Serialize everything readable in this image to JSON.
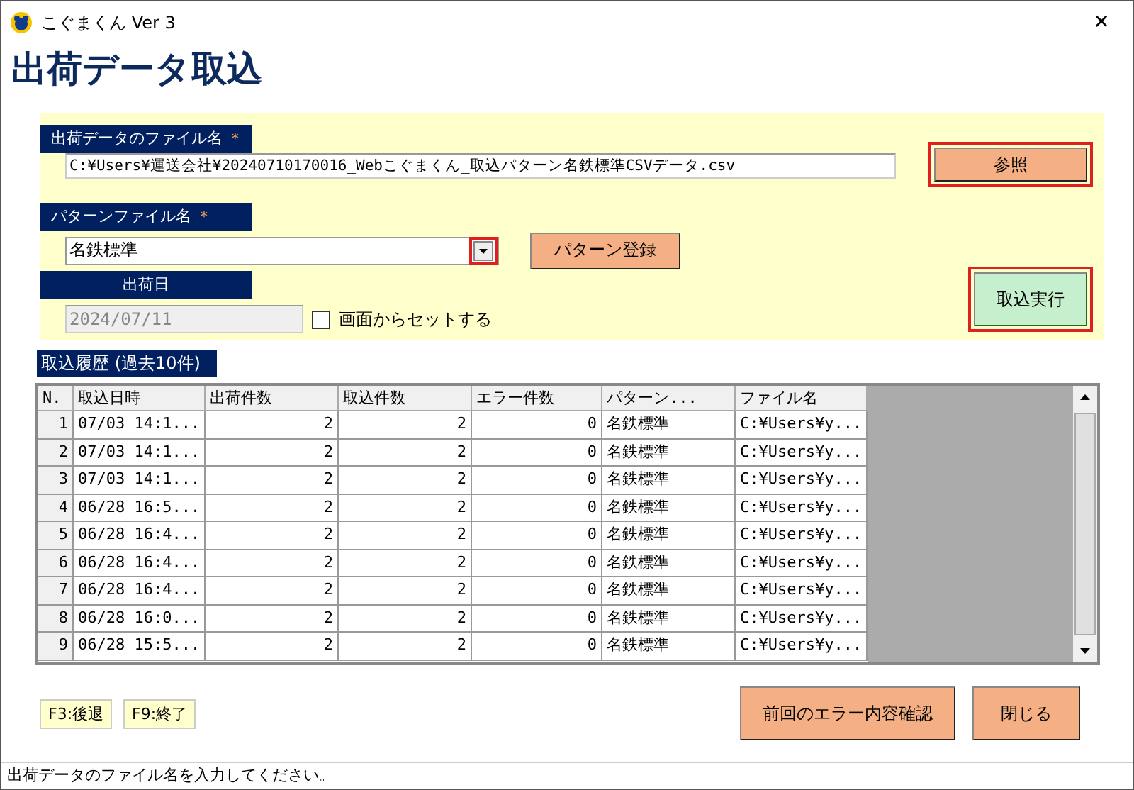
{
  "window": {
    "title": "こぐまくん Ver 3",
    "close": "✕"
  },
  "heading": "出荷データ取込",
  "file_field": {
    "label": "出荷データのファイル名",
    "required_mark": "＊",
    "value": "C:¥Users¥運送会社¥20240710170016_Webこぐまくん_取込パターン名鉄標準CSVデータ.csv"
  },
  "browse_button": {
    "label": "参照",
    "highlighted": true
  },
  "pattern_field": {
    "label": "パターンファイル名",
    "required_mark": "＊",
    "value": "名鉄標準",
    "dropdown_highlighted": true
  },
  "pattern_button": {
    "label": "パターン登録",
    "highlighted": false
  },
  "date_field": {
    "label": "出荷日",
    "value": "2024/07/11",
    "disabled": true
  },
  "set_from_screen": {
    "label": "画面からセットする",
    "checked": false
  },
  "import_button": {
    "label": "取込実行",
    "highlighted": true
  },
  "history": {
    "title": "取込履歴 (過去10件)",
    "columns": [
      "N.",
      "取込日時",
      "出荷件数",
      "取込件数",
      "エラー件数",
      "パターン...",
      "ファイル名"
    ],
    "rows": [
      [
        "1",
        "07/03 14:1...",
        "2",
        "2",
        "0",
        "名鉄標準",
        "C:¥Users¥y..."
      ],
      [
        "2",
        "07/03 14:1...",
        "2",
        "2",
        "0",
        "名鉄標準",
        "C:¥Users¥y..."
      ],
      [
        "3",
        "07/03 14:1...",
        "2",
        "2",
        "0",
        "名鉄標準",
        "C:¥Users¥y..."
      ],
      [
        "4",
        "06/28 16:5...",
        "2",
        "2",
        "0",
        "名鉄標準",
        "C:¥Users¥y..."
      ],
      [
        "5",
        "06/28 16:4...",
        "2",
        "2",
        "0",
        "名鉄標準",
        "C:¥Users¥y..."
      ],
      [
        "6",
        "06/28 16:4...",
        "2",
        "2",
        "0",
        "名鉄標準",
        "C:¥Users¥y..."
      ],
      [
        "7",
        "06/28 16:4...",
        "2",
        "2",
        "0",
        "名鉄標準",
        "C:¥Users¥y..."
      ],
      [
        "8",
        "06/28 16:0...",
        "2",
        "2",
        "0",
        "名鉄標準",
        "C:¥Users¥y..."
      ],
      [
        "9",
        "06/28 15:5...",
        "2",
        "2",
        "0",
        "名鉄標準",
        "C:¥Users¥y..."
      ]
    ]
  },
  "function_keys": [
    "F3:後退",
    "F9:終了"
  ],
  "buttons": [
    "前回のエラー内容確認",
    "閉じる"
  ],
  "status_bar": "出荷データのファイル名を入力してください。"
}
